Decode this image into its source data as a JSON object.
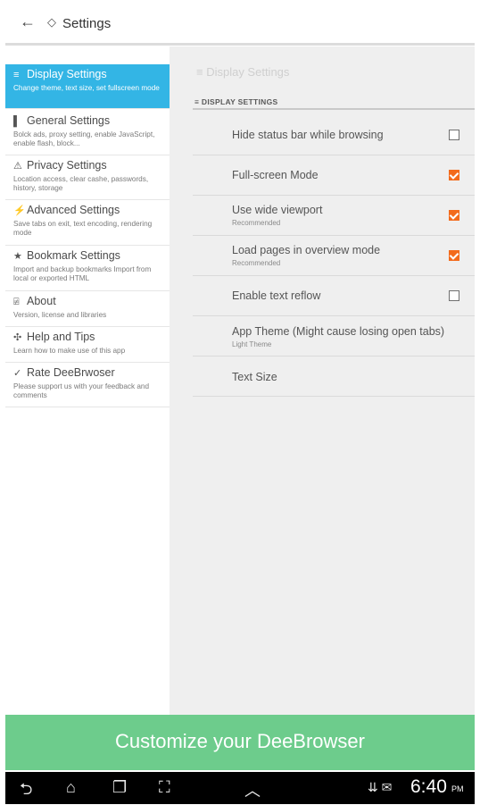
{
  "header": {
    "back_glyph": "←",
    "app_glyph": "◇",
    "title": "Settings"
  },
  "sidebar": {
    "items": [
      {
        "icon": "list-icon",
        "glyph": "≡",
        "label": "Display Settings",
        "desc": "Change theme, text size, set fullscreen mode",
        "active": true
      },
      {
        "icon": "shield-icon",
        "glyph": "▌",
        "label": "General Settings",
        "desc": "Bolck ads, proxy setting, enable JavaScript, enable flash, block...",
        "active": false
      },
      {
        "icon": "warning-icon",
        "glyph": "⚠",
        "label": "Privacy Settings",
        "desc": "Location access, clear cashe, passwords, history, storage",
        "active": false
      },
      {
        "icon": "lightning-icon",
        "glyph": "⚡",
        "label": "Advanced Settings",
        "desc": "Save tabs on exit, text encoding, rendering mode",
        "active": false
      },
      {
        "icon": "star-icon",
        "glyph": "★",
        "label": "Bookmark Settings",
        "desc": "Import and backup bookmarks Import from local or exported HTML",
        "active": false
      },
      {
        "icon": "info-icon",
        "glyph": "⍯",
        "label": "About",
        "desc": "Version, license and libraries",
        "active": false
      },
      {
        "icon": "tools-icon",
        "glyph": "✣",
        "label": "Help and Tips",
        "desc": "Learn how to make use of this app",
        "active": false
      },
      {
        "icon": "check-icon",
        "glyph": "✓",
        "label": "Rate DeeBrwoser",
        "desc": "Please support us with your feedback and comments",
        "active": false
      }
    ]
  },
  "main": {
    "pane_title": "≡ Display Settings",
    "section_header": "≡ DISPLAY SETTINGS",
    "rows": [
      {
        "title": "Hide status bar while browsing",
        "subtitle": "",
        "checkbox": true,
        "checked": false
      },
      {
        "title": "Full-screen Mode",
        "subtitle": "",
        "checkbox": true,
        "checked": true
      },
      {
        "title": "Use wide viewport",
        "subtitle": "Recommended",
        "checkbox": true,
        "checked": true
      },
      {
        "title": "Load pages in overview mode",
        "subtitle": "Recommended",
        "checkbox": true,
        "checked": true
      },
      {
        "title": "Enable text reflow",
        "subtitle": "",
        "checkbox": true,
        "checked": false
      },
      {
        "title": "App Theme (Might cause losing open tabs)",
        "subtitle": "Light Theme",
        "checkbox": false,
        "checked": false
      },
      {
        "title": "Text Size",
        "subtitle": "",
        "checkbox": false,
        "checked": false
      }
    ]
  },
  "banner": {
    "text": "Customize your DeeBrowser",
    "color": "#6dcc8c"
  },
  "navbar": {
    "back": "⮌",
    "home": "⌂",
    "recents": "❐",
    "screenshot": "⛶",
    "up": "︿",
    "status_icons": "⇊ ✉",
    "time": "6:40",
    "ampm": "PM"
  },
  "colors": {
    "accent": "#33b5e5",
    "checkbox_on": "#f36b1c"
  }
}
